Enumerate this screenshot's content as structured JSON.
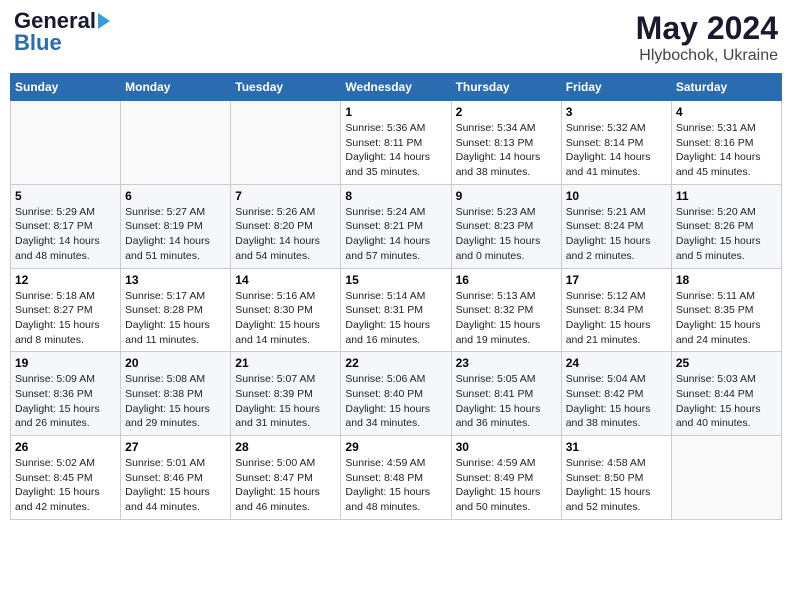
{
  "header": {
    "logo_general": "General",
    "logo_blue": "Blue",
    "month": "May 2024",
    "location": "Hlybochok, Ukraine"
  },
  "weekdays": [
    "Sunday",
    "Monday",
    "Tuesday",
    "Wednesday",
    "Thursday",
    "Friday",
    "Saturday"
  ],
  "weeks": [
    [
      {
        "day": "",
        "info": ""
      },
      {
        "day": "",
        "info": ""
      },
      {
        "day": "",
        "info": ""
      },
      {
        "day": "1",
        "info": "Sunrise: 5:36 AM\nSunset: 8:11 PM\nDaylight: 14 hours\nand 35 minutes."
      },
      {
        "day": "2",
        "info": "Sunrise: 5:34 AM\nSunset: 8:13 PM\nDaylight: 14 hours\nand 38 minutes."
      },
      {
        "day": "3",
        "info": "Sunrise: 5:32 AM\nSunset: 8:14 PM\nDaylight: 14 hours\nand 41 minutes."
      },
      {
        "day": "4",
        "info": "Sunrise: 5:31 AM\nSunset: 8:16 PM\nDaylight: 14 hours\nand 45 minutes."
      }
    ],
    [
      {
        "day": "5",
        "info": "Sunrise: 5:29 AM\nSunset: 8:17 PM\nDaylight: 14 hours\nand 48 minutes."
      },
      {
        "day": "6",
        "info": "Sunrise: 5:27 AM\nSunset: 8:19 PM\nDaylight: 14 hours\nand 51 minutes."
      },
      {
        "day": "7",
        "info": "Sunrise: 5:26 AM\nSunset: 8:20 PM\nDaylight: 14 hours\nand 54 minutes."
      },
      {
        "day": "8",
        "info": "Sunrise: 5:24 AM\nSunset: 8:21 PM\nDaylight: 14 hours\nand 57 minutes."
      },
      {
        "day": "9",
        "info": "Sunrise: 5:23 AM\nSunset: 8:23 PM\nDaylight: 15 hours\nand 0 minutes."
      },
      {
        "day": "10",
        "info": "Sunrise: 5:21 AM\nSunset: 8:24 PM\nDaylight: 15 hours\nand 2 minutes."
      },
      {
        "day": "11",
        "info": "Sunrise: 5:20 AM\nSunset: 8:26 PM\nDaylight: 15 hours\nand 5 minutes."
      }
    ],
    [
      {
        "day": "12",
        "info": "Sunrise: 5:18 AM\nSunset: 8:27 PM\nDaylight: 15 hours\nand 8 minutes."
      },
      {
        "day": "13",
        "info": "Sunrise: 5:17 AM\nSunset: 8:28 PM\nDaylight: 15 hours\nand 11 minutes."
      },
      {
        "day": "14",
        "info": "Sunrise: 5:16 AM\nSunset: 8:30 PM\nDaylight: 15 hours\nand 14 minutes."
      },
      {
        "day": "15",
        "info": "Sunrise: 5:14 AM\nSunset: 8:31 PM\nDaylight: 15 hours\nand 16 minutes."
      },
      {
        "day": "16",
        "info": "Sunrise: 5:13 AM\nSunset: 8:32 PM\nDaylight: 15 hours\nand 19 minutes."
      },
      {
        "day": "17",
        "info": "Sunrise: 5:12 AM\nSunset: 8:34 PM\nDaylight: 15 hours\nand 21 minutes."
      },
      {
        "day": "18",
        "info": "Sunrise: 5:11 AM\nSunset: 8:35 PM\nDaylight: 15 hours\nand 24 minutes."
      }
    ],
    [
      {
        "day": "19",
        "info": "Sunrise: 5:09 AM\nSunset: 8:36 PM\nDaylight: 15 hours\nand 26 minutes."
      },
      {
        "day": "20",
        "info": "Sunrise: 5:08 AM\nSunset: 8:38 PM\nDaylight: 15 hours\nand 29 minutes."
      },
      {
        "day": "21",
        "info": "Sunrise: 5:07 AM\nSunset: 8:39 PM\nDaylight: 15 hours\nand 31 minutes."
      },
      {
        "day": "22",
        "info": "Sunrise: 5:06 AM\nSunset: 8:40 PM\nDaylight: 15 hours\nand 34 minutes."
      },
      {
        "day": "23",
        "info": "Sunrise: 5:05 AM\nSunset: 8:41 PM\nDaylight: 15 hours\nand 36 minutes."
      },
      {
        "day": "24",
        "info": "Sunrise: 5:04 AM\nSunset: 8:42 PM\nDaylight: 15 hours\nand 38 minutes."
      },
      {
        "day": "25",
        "info": "Sunrise: 5:03 AM\nSunset: 8:44 PM\nDaylight: 15 hours\nand 40 minutes."
      }
    ],
    [
      {
        "day": "26",
        "info": "Sunrise: 5:02 AM\nSunset: 8:45 PM\nDaylight: 15 hours\nand 42 minutes."
      },
      {
        "day": "27",
        "info": "Sunrise: 5:01 AM\nSunset: 8:46 PM\nDaylight: 15 hours\nand 44 minutes."
      },
      {
        "day": "28",
        "info": "Sunrise: 5:00 AM\nSunset: 8:47 PM\nDaylight: 15 hours\nand 46 minutes."
      },
      {
        "day": "29",
        "info": "Sunrise: 4:59 AM\nSunset: 8:48 PM\nDaylight: 15 hours\nand 48 minutes."
      },
      {
        "day": "30",
        "info": "Sunrise: 4:59 AM\nSunset: 8:49 PM\nDaylight: 15 hours\nand 50 minutes."
      },
      {
        "day": "31",
        "info": "Sunrise: 4:58 AM\nSunset: 8:50 PM\nDaylight: 15 hours\nand 52 minutes."
      },
      {
        "day": "",
        "info": ""
      }
    ]
  ]
}
